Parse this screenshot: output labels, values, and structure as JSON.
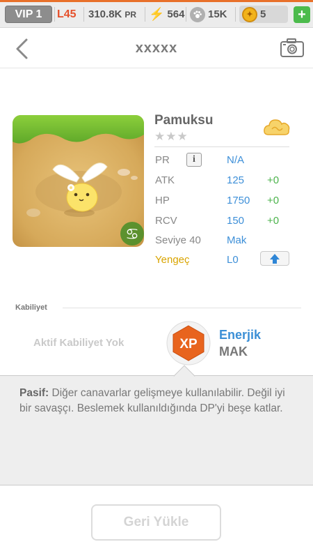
{
  "statusbar": {
    "vip": "VIP 1",
    "level": "L45",
    "power": "310.8K",
    "power_unit": "PR",
    "energy": "564",
    "paws": "15K",
    "coins": "5",
    "add": "+"
  },
  "nav": {
    "title": "xxxxx"
  },
  "monster": {
    "name": "Pamuksu",
    "stars": "★★★",
    "element_icon": "cancer-zodiac-icon",
    "stats": {
      "pr_label": "PR",
      "pr_value": "N/A",
      "atk_label": "ATK",
      "atk_value": "125",
      "atk_bonus": "+0",
      "hp_label": "HP",
      "hp_value": "1750",
      "hp_bonus": "+0",
      "rcv_label": "RCV",
      "rcv_value": "150",
      "rcv_bonus": "+0",
      "level_label": "Seviye 40",
      "level_value": "Mak",
      "sign_label": "Yengeç",
      "sign_value": "L0"
    }
  },
  "ability": {
    "header": "Kabiliyet",
    "active_none": "Aktif Kabiliyet Yok",
    "badge_text": "XP",
    "passive_name": "Enerjik",
    "passive_level": "MAK",
    "description_prefix": "Pasif:",
    "description": "Diğer canavarlar gelişmeye kullanılabilir. Değil iyi bir savaşçı. Beslemek kullanıldığında DP'yi beşe katlar."
  },
  "footer": {
    "restore_label": "Geri Yükle"
  },
  "colors": {
    "accent_blue": "#3d8fd8",
    "bonus_green": "#4cb34c",
    "level_red": "#e5502b",
    "sign_gold": "#d9a400",
    "xp_orange": "#e8641e"
  }
}
